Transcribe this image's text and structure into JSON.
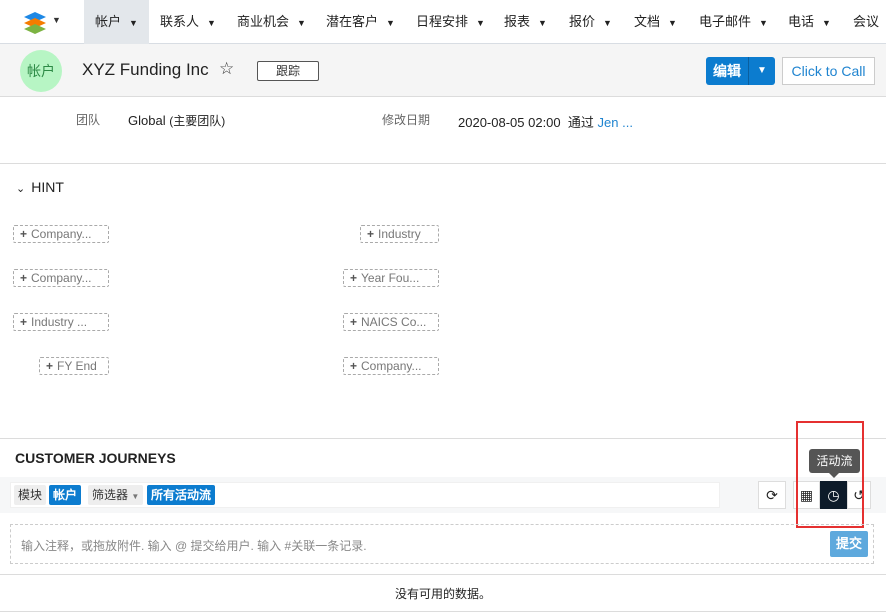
{
  "nav": {
    "items": [
      "帐户",
      "联系人",
      "商业机会",
      "潜在客户",
      "日程安排",
      "报表",
      "报价",
      "文档",
      "电子邮件",
      "电话",
      "会议"
    ],
    "active": "帐户"
  },
  "header": {
    "avatar_text": "帐户",
    "title": "XYZ Funding Inc",
    "follow_label": "跟踪",
    "edit_label": "编辑",
    "click_to_call": "Click to Call"
  },
  "details": {
    "team_label": "团队",
    "team_value": "Global",
    "team_note": "(主要团队)",
    "modified_label": "修改日期",
    "modified_value": "2020-08-05 02:00",
    "by_label": "通过",
    "by_user": "Jen ..."
  },
  "hint": {
    "title": "HINT",
    "left": [
      "Company...",
      "Company...",
      "Industry ...",
      "FY End"
    ],
    "right": [
      "Industry",
      "Year Fou...",
      "NAICS Co...",
      "Company..."
    ]
  },
  "journeys": {
    "title": "CUSTOMER JOURNEYS",
    "module_label": "模块",
    "module_value": "帐户",
    "filter_label": "筛选器",
    "filter_value": "所有活动流",
    "tooltip": "活动流",
    "composer_placeholder": "输入注释，或拖放附件. 输入 @ 提交给用户. 输入 #关联一条记录.",
    "submit_label": "提交",
    "empty_text": "没有可用的数据。"
  },
  "colors": {
    "primary": "#0c7ccf",
    "highlight_box": "#e53030",
    "avatar_bg": "#b7f5c4"
  }
}
